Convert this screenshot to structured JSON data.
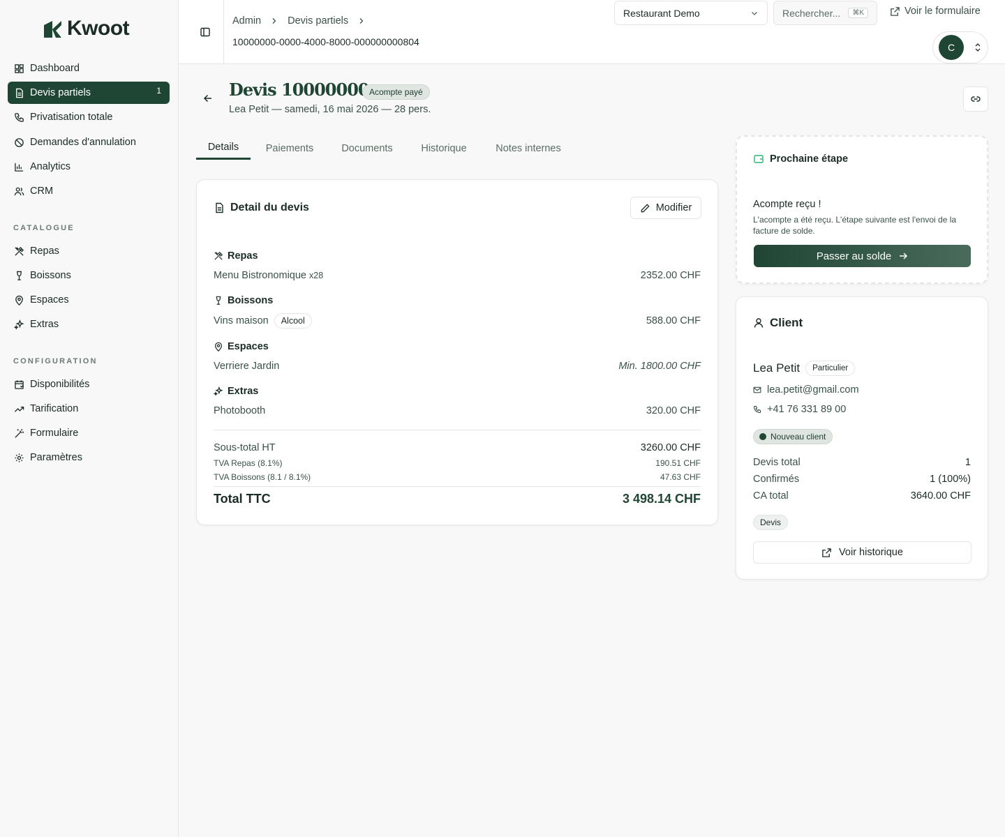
{
  "brand": {
    "name": "Kwoot"
  },
  "sidebar": {
    "items": [
      {
        "label": "Dashboard",
        "icon": "dashboard-icon"
      },
      {
        "label": "Devis partiels",
        "icon": "document-icon",
        "badge": "1",
        "active": true
      },
      {
        "label": "Privatisation totale",
        "icon": "phone-icon"
      },
      {
        "label": "Demandes d'annulation",
        "icon": "ban-icon"
      },
      {
        "label": "Analytics",
        "icon": "chart-icon"
      },
      {
        "label": "CRM",
        "icon": "users-icon"
      }
    ],
    "catalogue_title": "CATALOGUE",
    "catalogue": [
      {
        "label": "Repas",
        "icon": "utensils-icon"
      },
      {
        "label": "Boissons",
        "icon": "wine-icon"
      },
      {
        "label": "Espaces",
        "icon": "map-pin-icon"
      },
      {
        "label": "Extras",
        "icon": "sparkles-icon"
      }
    ],
    "config_title": "CONFIGURATION",
    "config": [
      {
        "label": "Disponibilités",
        "icon": "calendar-icon"
      },
      {
        "label": "Tarification",
        "icon": "trending-icon"
      },
      {
        "label": "Formulaire",
        "icon": "wand-icon"
      },
      {
        "label": "Paramètres",
        "icon": "gear-icon"
      }
    ]
  },
  "header": {
    "breadcrumb": [
      "Admin",
      "Devis partiels"
    ],
    "record_id": "10000000-0000-4000-8000-000000000804",
    "restaurant_select": "Restaurant Demo",
    "search_placeholder": "Rechercher...",
    "search_shortcut": "⌘K",
    "form_link": "Voir le formulaire",
    "avatar_initial": "C"
  },
  "devis": {
    "title": "Devis 10000000",
    "status": "Acompte payé",
    "subtitle": "Lea Petit — samedi, 16 mai 2026 — 28 pers."
  },
  "tabs": [
    "Details",
    "Paiements",
    "Documents",
    "Historique",
    "Notes internes"
  ],
  "detail": {
    "title": "Detail du devis",
    "modify_label": "Modifier",
    "sections": {
      "repas": {
        "title": "Repas",
        "item": "Menu Bistronomique",
        "qty": "x28",
        "price": "2352.00 CHF"
      },
      "boissons": {
        "title": "Boissons",
        "item": "Vins maison",
        "tag": "Alcool",
        "price": "588.00 CHF"
      },
      "espaces": {
        "title": "Espaces",
        "item": "Verriere Jardin",
        "price": "Min. 1800.00 CHF"
      },
      "extras": {
        "title": "Extras",
        "item": "Photobooth",
        "price": "320.00 CHF"
      }
    },
    "subtotal_label": "Sous-total HT",
    "subtotal_value": "3260.00 CHF",
    "tva_repas_label": "TVA Repas (8.1%)",
    "tva_repas_value": "190.51 CHF",
    "tva_boissons_label": "TVA Boissons (8.1 / 8.1%)",
    "tva_boissons_value": "47.63 CHF",
    "total_label": "Total TTC",
    "total_value": "3 498.14 CHF"
  },
  "next_step": {
    "title": "Prochaine étape",
    "heading": "Acompte reçu !",
    "description": "L'acompte a été reçu. L'étape suivante est l'envoi de la facture de solde.",
    "button": "Passer au solde"
  },
  "client": {
    "title": "Client",
    "name": "Lea Petit",
    "type": "Particulier",
    "email": "lea.petit@gmail.com",
    "phone": "+41 76 331 89 00",
    "status": "Nouveau client",
    "stats": [
      {
        "label": "Devis total",
        "value": "1"
      },
      {
        "label": "Confirmés",
        "value": "1 (100%)"
      },
      {
        "label": "CA total",
        "value": "3640.00 CHF"
      }
    ],
    "tag": "Devis",
    "history_button": "Voir historique"
  },
  "colors": {
    "primary": "#1f4535",
    "accent": "#2bb573",
    "background": "#f7f8f7"
  }
}
